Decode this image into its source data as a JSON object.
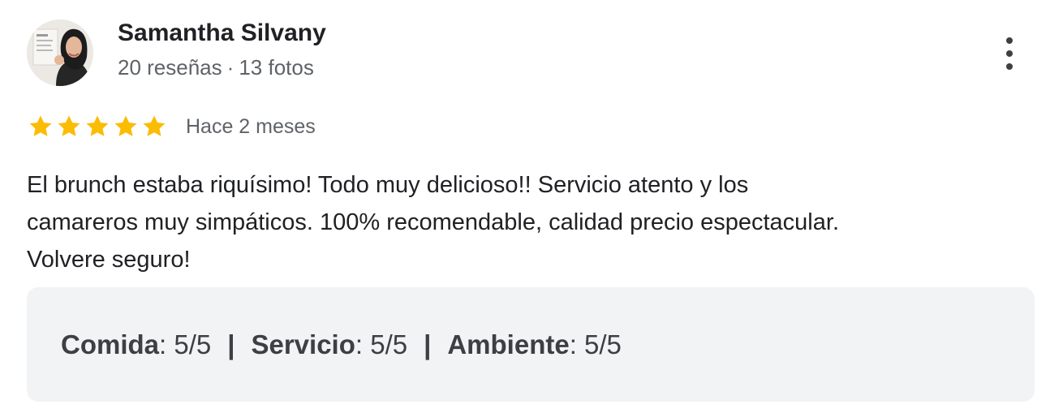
{
  "author": {
    "name": "Samantha Silvany",
    "reviews_count": "20 reseñas",
    "separator": "·",
    "photos_count": "13 fotos"
  },
  "review": {
    "rating": 5,
    "rating_max": 5,
    "date": "Hace 2 meses",
    "text": "El brunch estaba riquísimo! Todo muy delicioso!! Servicio atento y los\ncamareros muy simpáticos. 100% recomendable, calidad precio espectacular.\nVolvere seguro!",
    "star_color": "#fbbc04"
  },
  "attributes": [
    {
      "label": "Comida",
      "value": ": 5/5"
    },
    {
      "label": "Servicio",
      "value": ": 5/5"
    },
    {
      "label": "Ambiente",
      "value": ": 5/5"
    }
  ],
  "attribute_separator": "|",
  "icons": {
    "more": "more-vert-icon",
    "star": "star-icon"
  }
}
